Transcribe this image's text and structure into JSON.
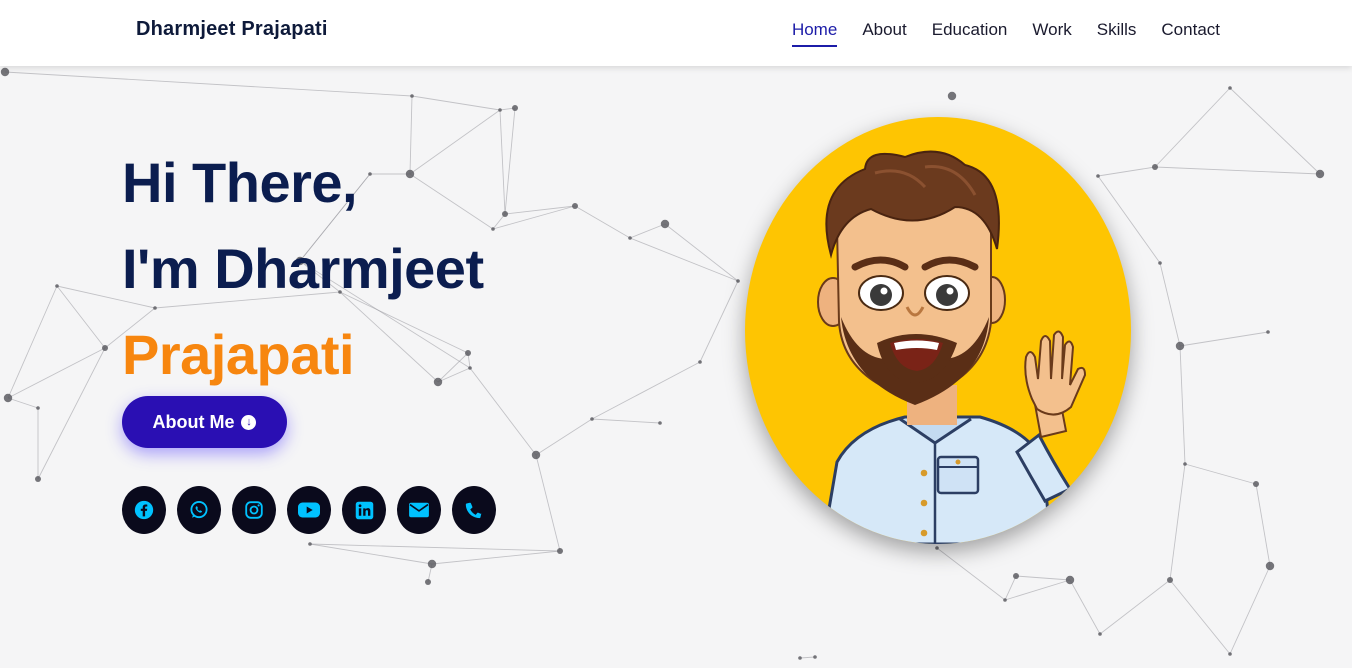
{
  "nav": {
    "brand": "Dharmjeet Prajapati",
    "links": [
      "Home",
      "About",
      "Education",
      "Work",
      "Skills",
      "Contact"
    ],
    "active": "Home"
  },
  "hero": {
    "line1": "Hi There,",
    "line2": "I'm Dharmjeet",
    "line3": "Prajapati",
    "button_label": "About Me",
    "button_icon": "arrow-down-circle-icon"
  },
  "socials": [
    "facebook-icon",
    "whatsapp-icon",
    "instagram-icon",
    "youtube-icon",
    "linkedin-icon",
    "envelope-icon",
    "phone-icon"
  ],
  "colors": {
    "heading": "#0b1d4f",
    "accent": "#f7860f",
    "button": "#2a0fb3",
    "nav_active": "#1c1ca8",
    "avatar_bg": "#fec502",
    "social_icon": "#00c2ff"
  }
}
